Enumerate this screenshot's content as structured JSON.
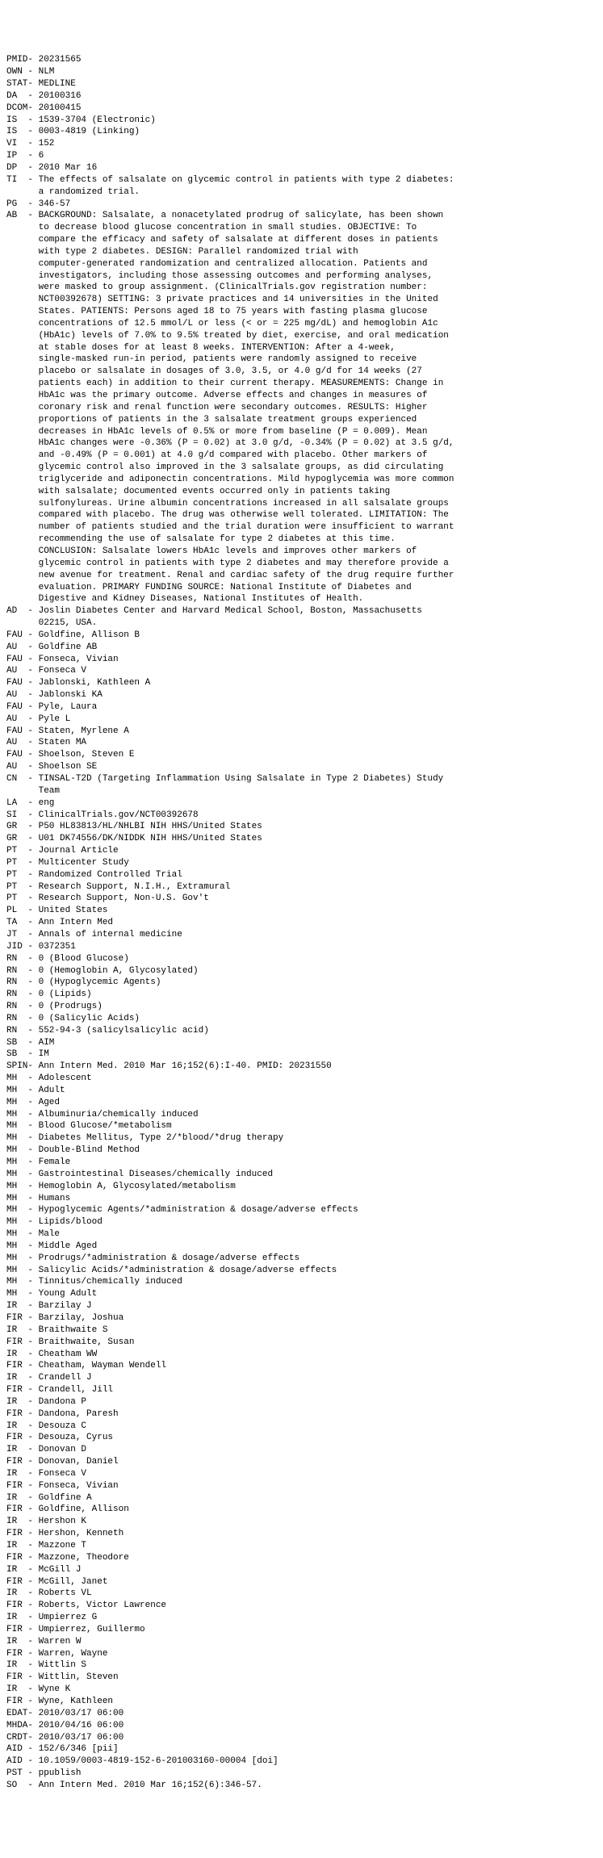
{
  "fields": [
    {
      "tag": "PMID",
      "sep": "-",
      "value": "20231565"
    },
    {
      "tag": "OWN",
      "sep": " -",
      "value": "NLM"
    },
    {
      "tag": "STAT",
      "sep": "-",
      "value": "MEDLINE"
    },
    {
      "tag": "DA",
      "sep": "  -",
      "value": "20100316"
    },
    {
      "tag": "DCOM",
      "sep": "-",
      "value": "20100415"
    },
    {
      "tag": "IS",
      "sep": "  -",
      "value": "1539-3704 (Electronic)"
    },
    {
      "tag": "IS",
      "sep": "  -",
      "value": "0003-4819 (Linking)"
    },
    {
      "tag": "VI",
      "sep": "  -",
      "value": "152"
    },
    {
      "tag": "IP",
      "sep": "  -",
      "value": "6"
    },
    {
      "tag": "DP",
      "sep": "  -",
      "value": "2010 Mar 16"
    },
    {
      "tag": "TI",
      "sep": "  -",
      "value": "The effects of salsalate on glycemic control in patients with type 2 diabetes: a randomized trial."
    },
    {
      "tag": "PG",
      "sep": "  -",
      "value": "346-57"
    },
    {
      "tag": "AB",
      "sep": "  -",
      "value": "BACKGROUND: Salsalate, a nonacetylated prodrug of salicylate, has been shown to decrease blood glucose concentration in small studies. OBJECTIVE: To compare the efficacy and safety of salsalate at different doses in patients with type 2 diabetes. DESIGN: Parallel randomized trial with computer-generated randomization and centralized allocation. Patients and investigators, including those assessing outcomes and performing analyses, were masked to group assignment. (ClinicalTrials.gov registration number: NCT00392678) SETTING: 3 private practices and 14 universities in the United States. PATIENTS: Persons aged 18 to 75 years with fasting plasma glucose concentrations of 12.5 mmol/L or less (< or = 225 mg/dL) and hemoglobin A1c (HbA1c) levels of 7.0% to 9.5% treated by diet, exercise, and oral medication at stable doses for at least 8 weeks. INTERVENTION: After a 4-week, single-masked run-in period, patients were randomly assigned to receive placebo or salsalate in dosages of 3.0, 3.5, or 4.0 g/d for 14 weeks (27 patients each) in addition to their current therapy. MEASUREMENTS: Change in HbA1c was the primary outcome. Adverse effects and changes in measures of coronary risk and renal function were secondary outcomes. RESULTS: Higher proportions of patients in the 3 salsalate treatment groups experienced decreases in HbA1c levels of 0.5% or more from baseline (P = 0.009). Mean HbA1c changes were -0.36% (P = 0.02) at 3.0 g/d, -0.34% (P = 0.02) at 3.5 g/d, and -0.49% (P = 0.001) at 4.0 g/d compared with placebo. Other markers of glycemic control also improved in the 3 salsalate groups, as did circulating triglyceride and adiponectin concentrations. Mild hypoglycemia was more common with salsalate; documented events occurred only in patients taking sulfonylureas. Urine albumin concentrations increased in all salsalate groups compared with placebo. The drug was otherwise well tolerated. LIMITATION: The number of patients studied and the trial duration were insufficient to warrant recommending the use of salsalate for type 2 diabetes at this time. CONCLUSION: Salsalate lowers HbA1c levels and improves other markers of glycemic control in patients with type 2 diabetes and may therefore provide a new avenue for treatment. Renal and cardiac safety of the drug require further evaluation. PRIMARY FUNDING SOURCE: National Institute of Diabetes and Digestive and Kidney Diseases, National Institutes of Health."
    },
    {
      "tag": "AD",
      "sep": "  -",
      "value": "Joslin Diabetes Center and Harvard Medical School, Boston, Massachusetts 02215, USA."
    },
    {
      "tag": "FAU",
      "sep": " -",
      "value": "Goldfine, Allison B"
    },
    {
      "tag": "AU",
      "sep": "  -",
      "value": "Goldfine AB"
    },
    {
      "tag": "FAU",
      "sep": " -",
      "value": "Fonseca, Vivian"
    },
    {
      "tag": "AU",
      "sep": "  -",
      "value": "Fonseca V"
    },
    {
      "tag": "FAU",
      "sep": " -",
      "value": "Jablonski, Kathleen A"
    },
    {
      "tag": "AU",
      "sep": "  -",
      "value": "Jablonski KA"
    },
    {
      "tag": "FAU",
      "sep": " -",
      "value": "Pyle, Laura"
    },
    {
      "tag": "AU",
      "sep": "  -",
      "value": "Pyle L"
    },
    {
      "tag": "FAU",
      "sep": " -",
      "value": "Staten, Myrlene A"
    },
    {
      "tag": "AU",
      "sep": "  -",
      "value": "Staten MA"
    },
    {
      "tag": "FAU",
      "sep": " -",
      "value": "Shoelson, Steven E"
    },
    {
      "tag": "AU",
      "sep": "  -",
      "value": "Shoelson SE"
    },
    {
      "tag": "CN",
      "sep": "  -",
      "value": "TINSAL-T2D (Targeting Inflammation Using Salsalate in Type 2 Diabetes) Study Team"
    },
    {
      "tag": "LA",
      "sep": "  -",
      "value": "eng"
    },
    {
      "tag": "SI",
      "sep": "  -",
      "value": "ClinicalTrials.gov/NCT00392678"
    },
    {
      "tag": "GR",
      "sep": "  -",
      "value": "P50 HL83813/HL/NHLBI NIH HHS/United States"
    },
    {
      "tag": "GR",
      "sep": "  -",
      "value": "U01 DK74556/DK/NIDDK NIH HHS/United States"
    },
    {
      "tag": "PT",
      "sep": "  -",
      "value": "Journal Article"
    },
    {
      "tag": "PT",
      "sep": "  -",
      "value": "Multicenter Study"
    },
    {
      "tag": "PT",
      "sep": "  -",
      "value": "Randomized Controlled Trial"
    },
    {
      "tag": "PT",
      "sep": "  -",
      "value": "Research Support, N.I.H., Extramural"
    },
    {
      "tag": "PT",
      "sep": "  -",
      "value": "Research Support, Non-U.S. Gov't"
    },
    {
      "tag": "PL",
      "sep": "  -",
      "value": "United States"
    },
    {
      "tag": "TA",
      "sep": "  -",
      "value": "Ann Intern Med"
    },
    {
      "tag": "JT",
      "sep": "  -",
      "value": "Annals of internal medicine"
    },
    {
      "tag": "JID",
      "sep": " -",
      "value": "0372351"
    },
    {
      "tag": "RN",
      "sep": "  -",
      "value": "0 (Blood Glucose)"
    },
    {
      "tag": "RN",
      "sep": "  -",
      "value": "0 (Hemoglobin A, Glycosylated)"
    },
    {
      "tag": "RN",
      "sep": "  -",
      "value": "0 (Hypoglycemic Agents)"
    },
    {
      "tag": "RN",
      "sep": "  -",
      "value": "0 (Lipids)"
    },
    {
      "tag": "RN",
      "sep": "  -",
      "value": "0 (Prodrugs)"
    },
    {
      "tag": "RN",
      "sep": "  -",
      "value": "0 (Salicylic Acids)"
    },
    {
      "tag": "RN",
      "sep": "  -",
      "value": "552-94-3 (salicylsalicylic acid)"
    },
    {
      "tag": "SB",
      "sep": "  -",
      "value": "AIM"
    },
    {
      "tag": "SB",
      "sep": "  -",
      "value": "IM"
    },
    {
      "tag": "SPIN",
      "sep": "-",
      "value": "Ann Intern Med. 2010 Mar 16;152(6):I-40. PMID: 20231550"
    },
    {
      "tag": "MH",
      "sep": "  -",
      "value": "Adolescent"
    },
    {
      "tag": "MH",
      "sep": "  -",
      "value": "Adult"
    },
    {
      "tag": "MH",
      "sep": "  -",
      "value": "Aged"
    },
    {
      "tag": "MH",
      "sep": "  -",
      "value": "Albuminuria/chemically induced"
    },
    {
      "tag": "MH",
      "sep": "  -",
      "value": "Blood Glucose/*metabolism"
    },
    {
      "tag": "MH",
      "sep": "  -",
      "value": "Diabetes Mellitus, Type 2/*blood/*drug therapy"
    },
    {
      "tag": "MH",
      "sep": "  -",
      "value": "Double-Blind Method"
    },
    {
      "tag": "MH",
      "sep": "  -",
      "value": "Female"
    },
    {
      "tag": "MH",
      "sep": "  -",
      "value": "Gastrointestinal Diseases/chemically induced"
    },
    {
      "tag": "MH",
      "sep": "  -",
      "value": "Hemoglobin A, Glycosylated/metabolism"
    },
    {
      "tag": "MH",
      "sep": "  -",
      "value": "Humans"
    },
    {
      "tag": "MH",
      "sep": "  -",
      "value": "Hypoglycemic Agents/*administration & dosage/adverse effects"
    },
    {
      "tag": "MH",
      "sep": "  -",
      "value": "Lipids/blood"
    },
    {
      "tag": "MH",
      "sep": "  -",
      "value": "Male"
    },
    {
      "tag": "MH",
      "sep": "  -",
      "value": "Middle Aged"
    },
    {
      "tag": "MH",
      "sep": "  -",
      "value": "Prodrugs/*administration & dosage/adverse effects"
    },
    {
      "tag": "MH",
      "sep": "  -",
      "value": "Salicylic Acids/*administration & dosage/adverse effects"
    },
    {
      "tag": "MH",
      "sep": "  -",
      "value": "Tinnitus/chemically induced"
    },
    {
      "tag": "MH",
      "sep": "  -",
      "value": "Young Adult"
    },
    {
      "tag": "IR",
      "sep": "  -",
      "value": "Barzilay J"
    },
    {
      "tag": "FIR",
      "sep": " -",
      "value": "Barzilay, Joshua"
    },
    {
      "tag": "IR",
      "sep": "  -",
      "value": "Braithwaite S"
    },
    {
      "tag": "FIR",
      "sep": " -",
      "value": "Braithwaite, Susan"
    },
    {
      "tag": "IR",
      "sep": "  -",
      "value": "Cheatham WW"
    },
    {
      "tag": "FIR",
      "sep": " -",
      "value": "Cheatham, Wayman Wendell"
    },
    {
      "tag": "IR",
      "sep": "  -",
      "value": "Crandell J"
    },
    {
      "tag": "FIR",
      "sep": " -",
      "value": "Crandell, Jill"
    },
    {
      "tag": "IR",
      "sep": "  -",
      "value": "Dandona P"
    },
    {
      "tag": "FIR",
      "sep": " -",
      "value": "Dandona, Paresh"
    },
    {
      "tag": "IR",
      "sep": "  -",
      "value": "Desouza C"
    },
    {
      "tag": "FIR",
      "sep": " -",
      "value": "Desouza, Cyrus"
    },
    {
      "tag": "IR",
      "sep": "  -",
      "value": "Donovan D"
    },
    {
      "tag": "FIR",
      "sep": " -",
      "value": "Donovan, Daniel"
    },
    {
      "tag": "IR",
      "sep": "  -",
      "value": "Fonseca V"
    },
    {
      "tag": "FIR",
      "sep": " -",
      "value": "Fonseca, Vivian"
    },
    {
      "tag": "IR",
      "sep": "  -",
      "value": "Goldfine A"
    },
    {
      "tag": "FIR",
      "sep": " -",
      "value": "Goldfine, Allison"
    },
    {
      "tag": "IR",
      "sep": "  -",
      "value": "Hershon K"
    },
    {
      "tag": "FIR",
      "sep": " -",
      "value": "Hershon, Kenneth"
    },
    {
      "tag": "IR",
      "sep": "  -",
      "value": "Mazzone T"
    },
    {
      "tag": "FIR",
      "sep": " -",
      "value": "Mazzone, Theodore"
    },
    {
      "tag": "IR",
      "sep": "  -",
      "value": "McGill J"
    },
    {
      "tag": "FIR",
      "sep": " -",
      "value": "McGill, Janet"
    },
    {
      "tag": "IR",
      "sep": "  -",
      "value": "Roberts VL"
    },
    {
      "tag": "FIR",
      "sep": " -",
      "value": "Roberts, Victor Lawrence"
    },
    {
      "tag": "IR",
      "sep": "  -",
      "value": "Umpierrez G"
    },
    {
      "tag": "FIR",
      "sep": " -",
      "value": "Umpierrez, Guillermo"
    },
    {
      "tag": "IR",
      "sep": "  -",
      "value": "Warren W"
    },
    {
      "tag": "FIR",
      "sep": " -",
      "value": "Warren, Wayne"
    },
    {
      "tag": "IR",
      "sep": "  -",
      "value": "Wittlin S"
    },
    {
      "tag": "FIR",
      "sep": " -",
      "value": "Wittlin, Steven"
    },
    {
      "tag": "IR",
      "sep": "  -",
      "value": "Wyne K"
    },
    {
      "tag": "FIR",
      "sep": " -",
      "value": "Wyne, Kathleen"
    },
    {
      "tag": "EDAT",
      "sep": "-",
      "value": "2010/03/17 06:00"
    },
    {
      "tag": "MHDA",
      "sep": "-",
      "value": "2010/04/16 06:00"
    },
    {
      "tag": "CRDT",
      "sep": "-",
      "value": "2010/03/17 06:00"
    },
    {
      "tag": "AID",
      "sep": " -",
      "value": "152/6/346 [pii]"
    },
    {
      "tag": "AID",
      "sep": " -",
      "value": "10.1059/0003-4819-152-6-201003160-00004 [doi]"
    },
    {
      "tag": "PST",
      "sep": " -",
      "value": "ppublish"
    },
    {
      "tag": "SO",
      "sep": "  -",
      "value": "Ann Intern Med. 2010 Mar 16;152(6):346-57."
    }
  ],
  "wrap_width": 84,
  "indent": "      "
}
